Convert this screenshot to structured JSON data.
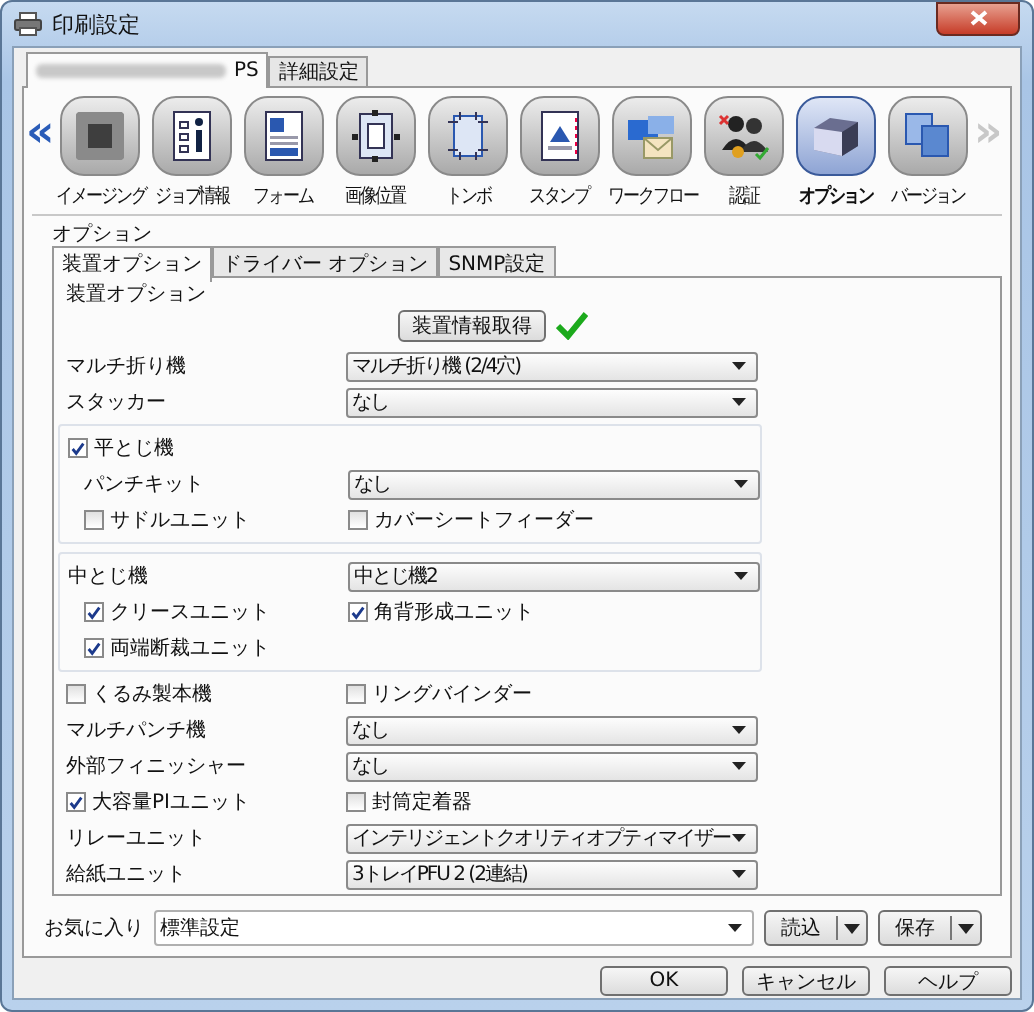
{
  "window": {
    "title": "印刷設定"
  },
  "top_tabs": [
    {
      "label": "PS",
      "blurred": true,
      "selected": true
    },
    {
      "label": "詳細設定",
      "blurred": false,
      "selected": false
    }
  ],
  "toolbar": {
    "prev": {
      "label": "«",
      "disabled": false
    },
    "next": {
      "label": "»",
      "disabled": true
    },
    "items": [
      {
        "label": "イメージング",
        "kind": "imaging",
        "selected": false
      },
      {
        "label": "ジョブ情報",
        "kind": "job",
        "selected": false
      },
      {
        "label": "フォーム",
        "kind": "form",
        "selected": false
      },
      {
        "label": "画像位置",
        "kind": "position",
        "selected": false
      },
      {
        "label": "トンボ",
        "kind": "trim",
        "selected": false
      },
      {
        "label": "スタンプ",
        "kind": "stamp",
        "selected": false
      },
      {
        "label": "ワークフロー",
        "kind": "workflow",
        "selected": false
      },
      {
        "label": "認証",
        "kind": "auth",
        "selected": false
      },
      {
        "label": "オプション",
        "kind": "option",
        "selected": true
      },
      {
        "label": "バージョン",
        "kind": "version",
        "selected": false
      }
    ]
  },
  "options": {
    "title": "オプション",
    "tabs": [
      {
        "label": "装置オプション",
        "selected": true
      },
      {
        "label": "ドライバー オプション",
        "selected": false
      },
      {
        "label": "SNMP設定",
        "selected": false
      }
    ],
    "panel_title": "装置オプション",
    "fetch_button": {
      "label": "装置情報取得",
      "done": true
    },
    "sections": [
      {
        "kind": "plain",
        "rows": [
          {
            "kind": "select",
            "label": "マルチ折り機",
            "value": "マルチ折り機 (2/4穴)"
          },
          {
            "kind": "select",
            "label": "スタッカー",
            "value": "なし"
          }
        ]
      },
      {
        "kind": "box",
        "rows": [
          {
            "kind": "check",
            "label": "平とじ機",
            "checked": true,
            "children": [
              {
                "kind": "select",
                "label": "パンチキット",
                "value": "なし"
              },
              {
                "kind": "pair",
                "left": {
                  "label": "サドルユニット",
                  "checked": false
                },
                "right": {
                  "label": "カバーシートフィーダー",
                  "checked": false
                }
              }
            ]
          }
        ]
      },
      {
        "kind": "box",
        "rows": [
          {
            "kind": "select",
            "label": "中とじ機",
            "value": "中とじ機2",
            "children": [
              {
                "kind": "pair",
                "left": {
                  "label": "クリースユニット",
                  "checked": true
                },
                "right": {
                  "label": "角背形成ユニット",
                  "checked": true
                }
              },
              {
                "kind": "check",
                "label": "両端断裁ユニット",
                "checked": true
              }
            ]
          }
        ]
      },
      {
        "kind": "plain",
        "rows": [
          {
            "kind": "pair",
            "left": {
              "label": "くるみ製本機",
              "checked": false
            },
            "right": {
              "label": "リングバインダー",
              "checked": false
            }
          },
          {
            "kind": "select",
            "label": "マルチパンチ機",
            "value": "なし"
          },
          {
            "kind": "select",
            "label": "外部フィニッシャー",
            "value": "なし"
          },
          {
            "kind": "pair",
            "left": {
              "label": "大容量PIユニット",
              "checked": true
            },
            "right": {
              "label": "封筒定着器",
              "checked": false
            }
          },
          {
            "kind": "select",
            "label": "リレーユニット",
            "value": "インテリジェントクオリティオプティマイザー"
          },
          {
            "kind": "select",
            "label": "給紙ユニット",
            "value": "3トレイPFU 2 (2連結)"
          }
        ]
      }
    ]
  },
  "favorites": {
    "label": "お気に入り",
    "value": "標準設定",
    "buttons": [
      "読込",
      "保存"
    ]
  },
  "buttons": [
    "OK",
    "キャンセル",
    "ヘルプ"
  ]
}
